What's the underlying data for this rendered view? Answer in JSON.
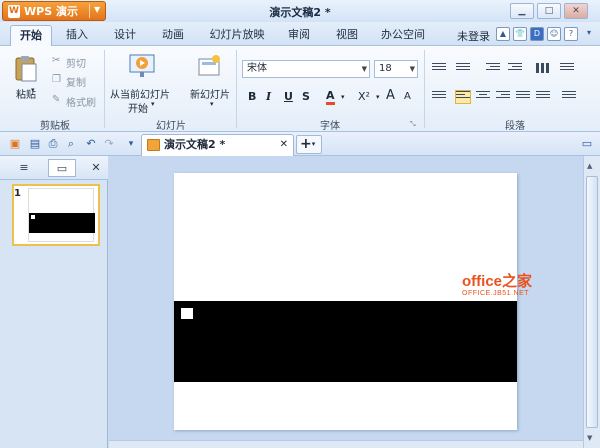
{
  "titlebar": {
    "app_name": "WPS 演示",
    "doc_title": "演示文稿2 *"
  },
  "menu": {
    "tabs": [
      "开始",
      "插入",
      "设计",
      "动画",
      "幻灯片放映",
      "审阅",
      "视图",
      "办公空间"
    ],
    "active_tab": "开始",
    "login": "未登录"
  },
  "ribbon": {
    "clipboard": {
      "paste": "粘贴",
      "cut": "剪切",
      "copy": "复制",
      "format_painter": "格式刷",
      "group": "剪贴板"
    },
    "slides": {
      "play_from_current_1": "从当前幻灯片",
      "play_from_current_2": "开始",
      "new_slide": "新幻灯片",
      "group": "幻灯片"
    },
    "font": {
      "font_name": "宋体",
      "font_size": "18",
      "bold": "B",
      "italic": "I",
      "underline": "U",
      "strike": "S",
      "color": "A",
      "superscript": "X²",
      "grow": "A",
      "shrink": "A",
      "group": "字体"
    },
    "paragraph": {
      "group": "段落"
    }
  },
  "doc_tabs": {
    "active": "演示文稿2 *",
    "new_tab": "+"
  },
  "slides_panel": {
    "slide_number": "1"
  },
  "watermark": {
    "line1": "office之家",
    "line2": "OFFICE.JB51.NET"
  },
  "colors": {
    "accent": "#e4731c",
    "active_slide_border": "#f0c04d",
    "watermark": "#e8531e"
  }
}
